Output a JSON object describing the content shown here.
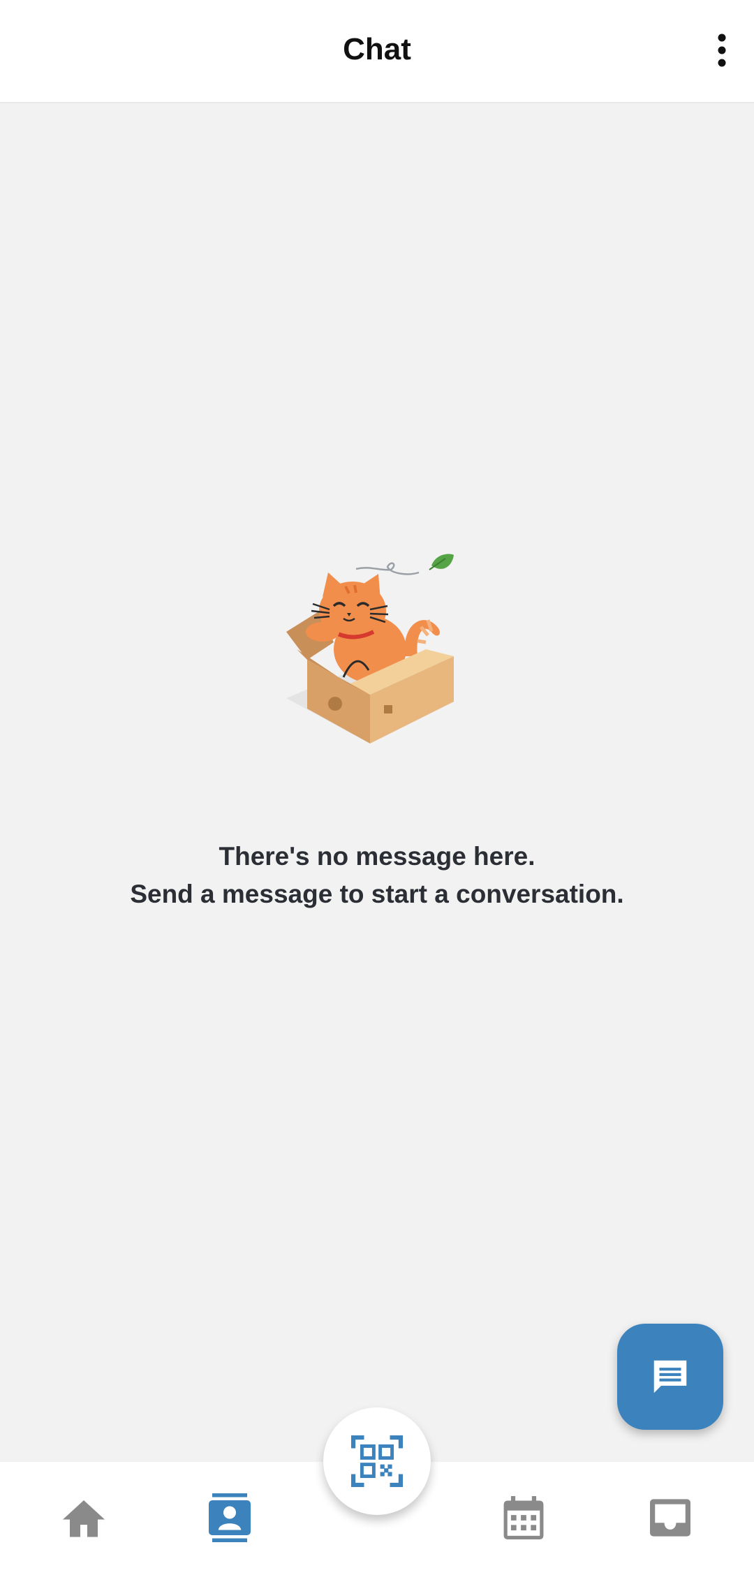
{
  "header": {
    "title": "Chat",
    "menu_icon": "more-vertical-icon"
  },
  "empty_state": {
    "illustration": "cat-in-box-illustration",
    "line1": "There's no message here.",
    "line2": "Send a message to start a conversation."
  },
  "fab": {
    "icon": "message-icon",
    "color": "#3c83bd"
  },
  "bottom_nav": {
    "center_button_icon": "qr-code-scan-icon",
    "items": [
      {
        "name": "home",
        "icon": "home-icon",
        "active": false
      },
      {
        "name": "contacts",
        "icon": "contacts-icon",
        "active": true
      },
      {
        "name": "calendar",
        "icon": "calendar-icon",
        "active": false
      },
      {
        "name": "inbox",
        "icon": "inbox-icon",
        "active": false
      }
    ],
    "active_color": "#3c83bd",
    "inactive_color": "#8a8a8a"
  }
}
